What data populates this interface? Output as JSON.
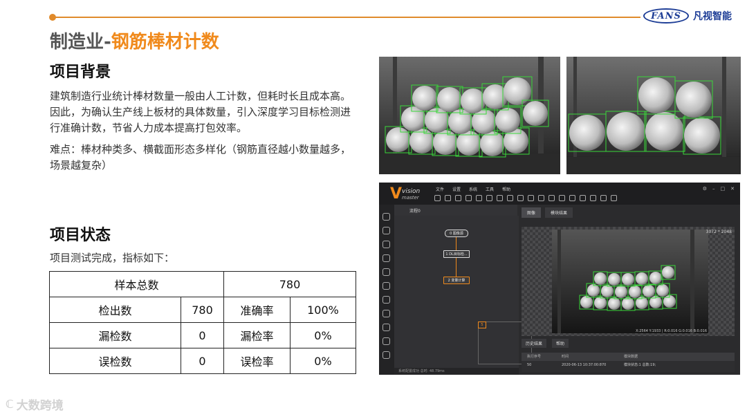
{
  "header": {
    "logo_text": "FANS",
    "logo_cn": "凡视智能"
  },
  "title": {
    "prefix": "制造业-",
    "highlight": "钢筋棒材计数"
  },
  "background": {
    "heading": "项目背景",
    "paragraph1": "建筑制造行业统计棒材数量一般由人工计数，但耗时长且成本高。因此，为确认生产线上板材的具体数量，引入深度学习目标检测进行准确计数，节省人力成本提高打包效率。",
    "paragraph2": "难点：棒材种类多、横截面形态多样化（钢筋直径越小数量越多，场景越复杂）"
  },
  "status": {
    "heading": "项目状态",
    "intro": "项目测试完成，指标如下：",
    "table": {
      "total_label": "样本总数",
      "total_value": "780",
      "rows": [
        {
          "label": "检出数",
          "value": "780",
          "rate_label": "准确率",
          "rate_value": "100%"
        },
        {
          "label": "漏检数",
          "value": "0",
          "rate_label": "漏检率",
          "rate_value": "0%"
        },
        {
          "label": "误检数",
          "value": "0",
          "rate_label": "误检率",
          "rate_value": "0%"
        }
      ]
    }
  },
  "software": {
    "logo_v": "V",
    "logo_top": "vision",
    "logo_bottom": "master",
    "menu": [
      "文件",
      "设置",
      "系统",
      "工具",
      "帮助"
    ],
    "flow_tab": "流程0",
    "nodes": {
      "start": "0 图像源",
      "a": "1 DL目标检...",
      "b": "2 变量计算"
    },
    "minimap_label": "5",
    "view_tabs": [
      "图像",
      "模块结果"
    ],
    "resolution": "3072 * 2048",
    "coord_readout": "X:2564 Y:1933 | R:0.016 G:0.016 B:0.016",
    "status_text": "系统配置成功 总时: 48.79ms",
    "bottom_tabs": [
      "历史结果",
      "帮助"
    ],
    "result_headers": [
      "执行序号",
      "时间",
      "模块数据"
    ],
    "result_row": [
      "50",
      "2020-06-13 10:37:00:870",
      "模块状态:1 总数:19;"
    ]
  },
  "watermark": {
    "icon": "ℂ",
    "text": "大数跨境"
  }
}
